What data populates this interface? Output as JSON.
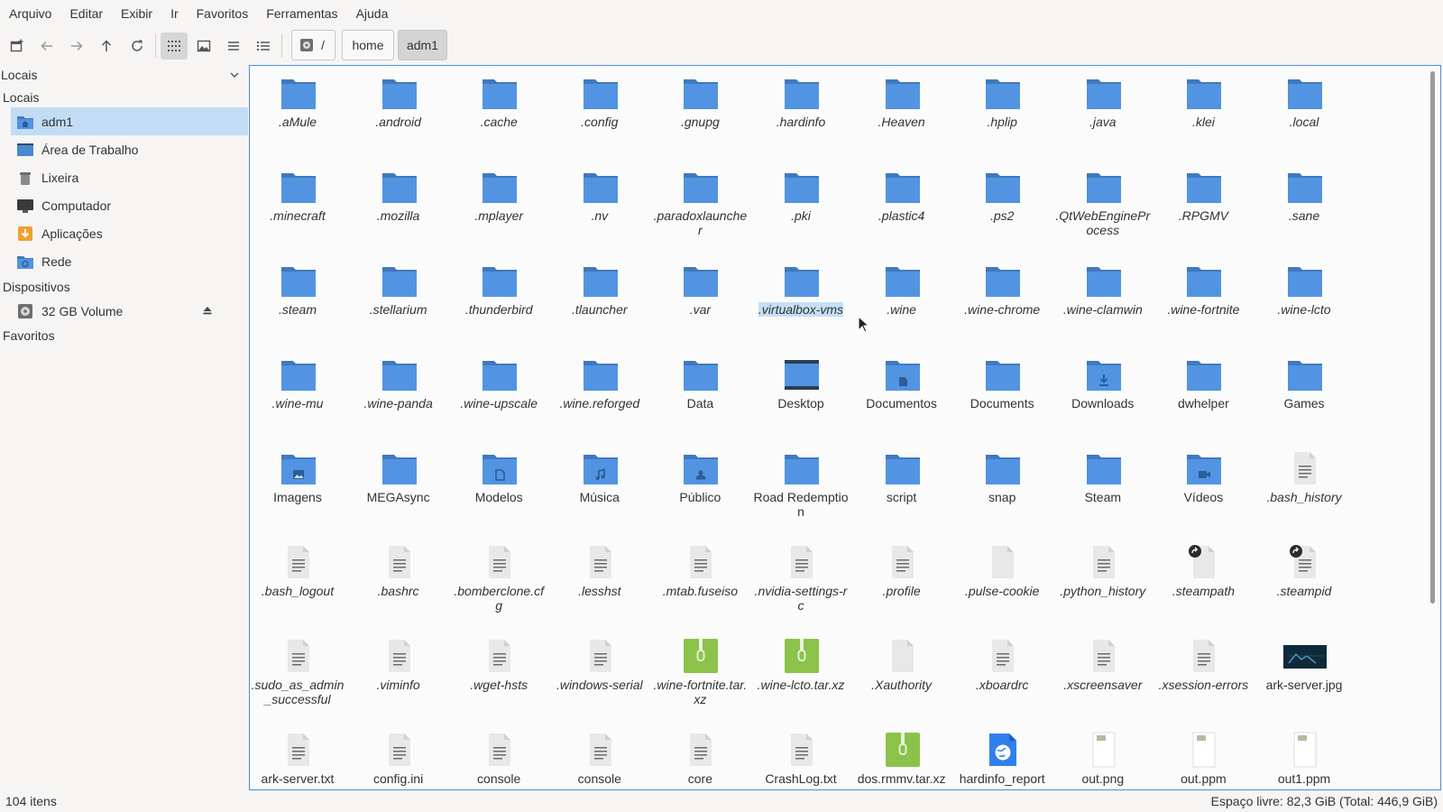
{
  "menu": [
    "Arquivo",
    "Editar",
    "Exibir",
    "Ir",
    "Favoritos",
    "Ferramentas",
    "Ajuda"
  ],
  "path": {
    "root_label": "/",
    "segments": [
      "home",
      "adm1"
    ]
  },
  "sidebar": {
    "header": "Locais",
    "sections": [
      {
        "title": "Locais",
        "items": [
          {
            "label": "adm1",
            "icon": "home-folder-icon",
            "selected": true
          },
          {
            "label": "Área de Trabalho",
            "icon": "desktop-icon"
          },
          {
            "label": "Lixeira",
            "icon": "trash-icon"
          },
          {
            "label": "Computador",
            "icon": "computer-icon"
          },
          {
            "label": "Aplicações",
            "icon": "applications-icon"
          },
          {
            "label": "Rede",
            "icon": "network-icon"
          }
        ]
      },
      {
        "title": "Dispositivos",
        "items": [
          {
            "label": "32 GB Volume",
            "icon": "drive-icon",
            "eject": true
          }
        ]
      },
      {
        "title": "Favoritos",
        "items": []
      }
    ]
  },
  "files": [
    {
      "name": ".aMule",
      "type": "folder",
      "hidden": true
    },
    {
      "name": ".android",
      "type": "folder",
      "hidden": true
    },
    {
      "name": ".cache",
      "type": "folder",
      "hidden": true
    },
    {
      "name": ".config",
      "type": "folder",
      "hidden": true
    },
    {
      "name": ".gnupg",
      "type": "folder",
      "hidden": true
    },
    {
      "name": ".hardinfo",
      "type": "folder",
      "hidden": true
    },
    {
      "name": ".Heaven",
      "type": "folder",
      "hidden": true
    },
    {
      "name": ".hplip",
      "type": "folder",
      "hidden": true
    },
    {
      "name": ".java",
      "type": "folder",
      "hidden": true
    },
    {
      "name": ".klei",
      "type": "folder",
      "hidden": true
    },
    {
      "name": ".local",
      "type": "folder",
      "hidden": true
    },
    {
      "name": ".minecraft",
      "type": "folder",
      "hidden": true
    },
    {
      "name": ".mozilla",
      "type": "folder",
      "hidden": true
    },
    {
      "name": ".mplayer",
      "type": "folder",
      "hidden": true
    },
    {
      "name": ".nv",
      "type": "folder",
      "hidden": true
    },
    {
      "name": ".paradoxlauncher",
      "type": "folder",
      "hidden": true
    },
    {
      "name": ".pki",
      "type": "folder",
      "hidden": true
    },
    {
      "name": ".plastic4",
      "type": "folder",
      "hidden": true
    },
    {
      "name": ".ps2",
      "type": "folder",
      "hidden": true
    },
    {
      "name": ".QtWebEngineProcess",
      "type": "folder",
      "hidden": true
    },
    {
      "name": ".RPGMV",
      "type": "folder",
      "hidden": true
    },
    {
      "name": ".sane",
      "type": "folder",
      "hidden": true
    },
    {
      "name": ".steam",
      "type": "folder",
      "hidden": true
    },
    {
      "name": ".stellarium",
      "type": "folder",
      "hidden": true
    },
    {
      "name": ".thunderbird",
      "type": "folder",
      "hidden": true
    },
    {
      "name": ".tlauncher",
      "type": "folder",
      "hidden": true
    },
    {
      "name": ".var",
      "type": "folder",
      "hidden": true
    },
    {
      "name": ".virtualbox-vms",
      "type": "folder",
      "hidden": true,
      "selected": true
    },
    {
      "name": ".wine",
      "type": "folder",
      "hidden": true
    },
    {
      "name": ".wine-chrome",
      "type": "folder",
      "hidden": true
    },
    {
      "name": ".wine-clamwin",
      "type": "folder",
      "hidden": true
    },
    {
      "name": ".wine-fortnite",
      "type": "folder",
      "hidden": true
    },
    {
      "name": ".wine-lcto",
      "type": "folder",
      "hidden": true
    },
    {
      "name": ".wine-mu",
      "type": "folder",
      "hidden": true
    },
    {
      "name": ".wine-panda",
      "type": "folder",
      "hidden": true
    },
    {
      "name": ".wine-upscale",
      "type": "folder",
      "hidden": true
    },
    {
      "name": ".wine.reforged",
      "type": "folder",
      "hidden": true
    },
    {
      "name": "Data",
      "type": "folder"
    },
    {
      "name": "Desktop",
      "type": "desktop"
    },
    {
      "name": "Documentos",
      "type": "folder",
      "emblem": "document"
    },
    {
      "name": "Documents",
      "type": "folder"
    },
    {
      "name": "Downloads",
      "type": "folder",
      "emblem": "download"
    },
    {
      "name": "dwhelper",
      "type": "folder"
    },
    {
      "name": "Games",
      "type": "folder"
    },
    {
      "name": "Imagens",
      "type": "folder",
      "emblem": "image"
    },
    {
      "name": "MEGAsync",
      "type": "folder"
    },
    {
      "name": "Modelos",
      "type": "folder",
      "emblem": "template"
    },
    {
      "name": "Música",
      "type": "folder",
      "emblem": "music"
    },
    {
      "name": "Público",
      "type": "folder",
      "emblem": "user"
    },
    {
      "name": "Road Redemption",
      "type": "folder"
    },
    {
      "name": "script",
      "type": "folder"
    },
    {
      "name": "snap",
      "type": "folder"
    },
    {
      "name": "Steam",
      "type": "folder"
    },
    {
      "name": "Vídeos",
      "type": "folder",
      "emblem": "video"
    },
    {
      "name": ".bash_history",
      "type": "text",
      "hidden": true
    },
    {
      "name": ".bash_logout",
      "type": "text",
      "hidden": true
    },
    {
      "name": ".bashrc",
      "type": "text",
      "hidden": true
    },
    {
      "name": ".bomberclone.cfg",
      "type": "text",
      "hidden": true
    },
    {
      "name": ".lesshst",
      "type": "text",
      "hidden": true
    },
    {
      "name": ".mtab.fuseiso",
      "type": "text",
      "hidden": true
    },
    {
      "name": ".nvidia-settings-rc",
      "type": "text",
      "hidden": true
    },
    {
      "name": ".profile",
      "type": "text",
      "hidden": true
    },
    {
      "name": ".pulse-cookie",
      "type": "blank",
      "hidden": true
    },
    {
      "name": ".python_history",
      "type": "text",
      "hidden": true
    },
    {
      "name": ".steampath",
      "type": "link",
      "hidden": true
    },
    {
      "name": ".steampid",
      "type": "link-text",
      "hidden": true
    },
    {
      "name": ".sudo_as_admin_successful",
      "type": "text",
      "hidden": true
    },
    {
      "name": ".viminfo",
      "type": "text",
      "hidden": true
    },
    {
      "name": ".wget-hsts",
      "type": "text",
      "hidden": true
    },
    {
      "name": ".windows-serial",
      "type": "text",
      "hidden": true
    },
    {
      "name": ".wine-fortnite.tar.xz",
      "type": "archive",
      "hidden": true
    },
    {
      "name": ".wine-lcto.tar.xz",
      "type": "archive",
      "hidden": true
    },
    {
      "name": ".Xauthority",
      "type": "blank",
      "hidden": true
    },
    {
      "name": ".xboardrc",
      "type": "text",
      "hidden": true
    },
    {
      "name": ".xscreensaver",
      "type": "text",
      "hidden": true
    },
    {
      "name": ".xsession-errors",
      "type": "text",
      "hidden": true
    },
    {
      "name": "ark-server.jpg",
      "type": "image"
    },
    {
      "name": "ark-server.txt",
      "type": "text"
    },
    {
      "name": "config.ini",
      "type": "text"
    },
    {
      "name": "console",
      "type": "text"
    },
    {
      "name": "console",
      "type": "text"
    },
    {
      "name": "core",
      "type": "text"
    },
    {
      "name": "CrashLog.txt",
      "type": "text"
    },
    {
      "name": "dos.rmmv.tar.xz",
      "type": "archive"
    },
    {
      "name": "hardinfo_report",
      "type": "html"
    },
    {
      "name": "out.png",
      "type": "thumb"
    },
    {
      "name": "out.ppm",
      "type": "thumb"
    },
    {
      "name": "out1.ppm",
      "type": "thumb"
    }
  ],
  "status": {
    "count": "104 itens",
    "space": "Espaço livre: 82,3 GiB (Total: 446,9 GiB)"
  },
  "colors": {
    "folder": "#5294e2",
    "folder_dark": "#4179bd",
    "selection": "#c2dcf3",
    "archive": "#8bc34a",
    "accent": "#4a90d9"
  }
}
